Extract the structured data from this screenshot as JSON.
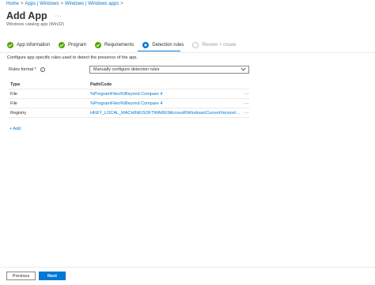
{
  "breadcrumb": {
    "items": [
      "Home",
      "Apps | Windows",
      "Windows | Windows apps"
    ],
    "separator": ">"
  },
  "header": {
    "title": "Add App",
    "more_label": "···",
    "subtitle": "Windows catalog app (Win32)"
  },
  "steps": [
    {
      "label": "App information",
      "state": "done"
    },
    {
      "label": "Program",
      "state": "done"
    },
    {
      "label": "Requirements",
      "state": "done"
    },
    {
      "label": "Detection rules",
      "state": "current"
    },
    {
      "label": "Review + create",
      "state": "pending"
    }
  ],
  "main": {
    "description": "Configure app specific rules used to detect the presence of the app.",
    "rules_format_label": "Rules format *",
    "rules_format_value": "Manually configure detection rules",
    "table": {
      "columns": [
        "Type",
        "Path/Code"
      ],
      "rows": [
        {
          "type": "File",
          "path": "%ProgramFiles%\\Beyond Compare 4"
        },
        {
          "type": "File",
          "path": "%ProgramFiles%\\Beyond Compare 4"
        },
        {
          "type": "Registry",
          "path": "HKEY_LOCAL_MACHINE\\SOFTWARE\\Microsoft\\Windows\\CurrentVersion\\Unins..."
        }
      ],
      "row_action": "···"
    },
    "add_label": "+ Add"
  },
  "footer": {
    "previous_label": "Previous",
    "next_label": "Next"
  },
  "colors": {
    "accent": "#0078d4",
    "success": "#57a300"
  }
}
